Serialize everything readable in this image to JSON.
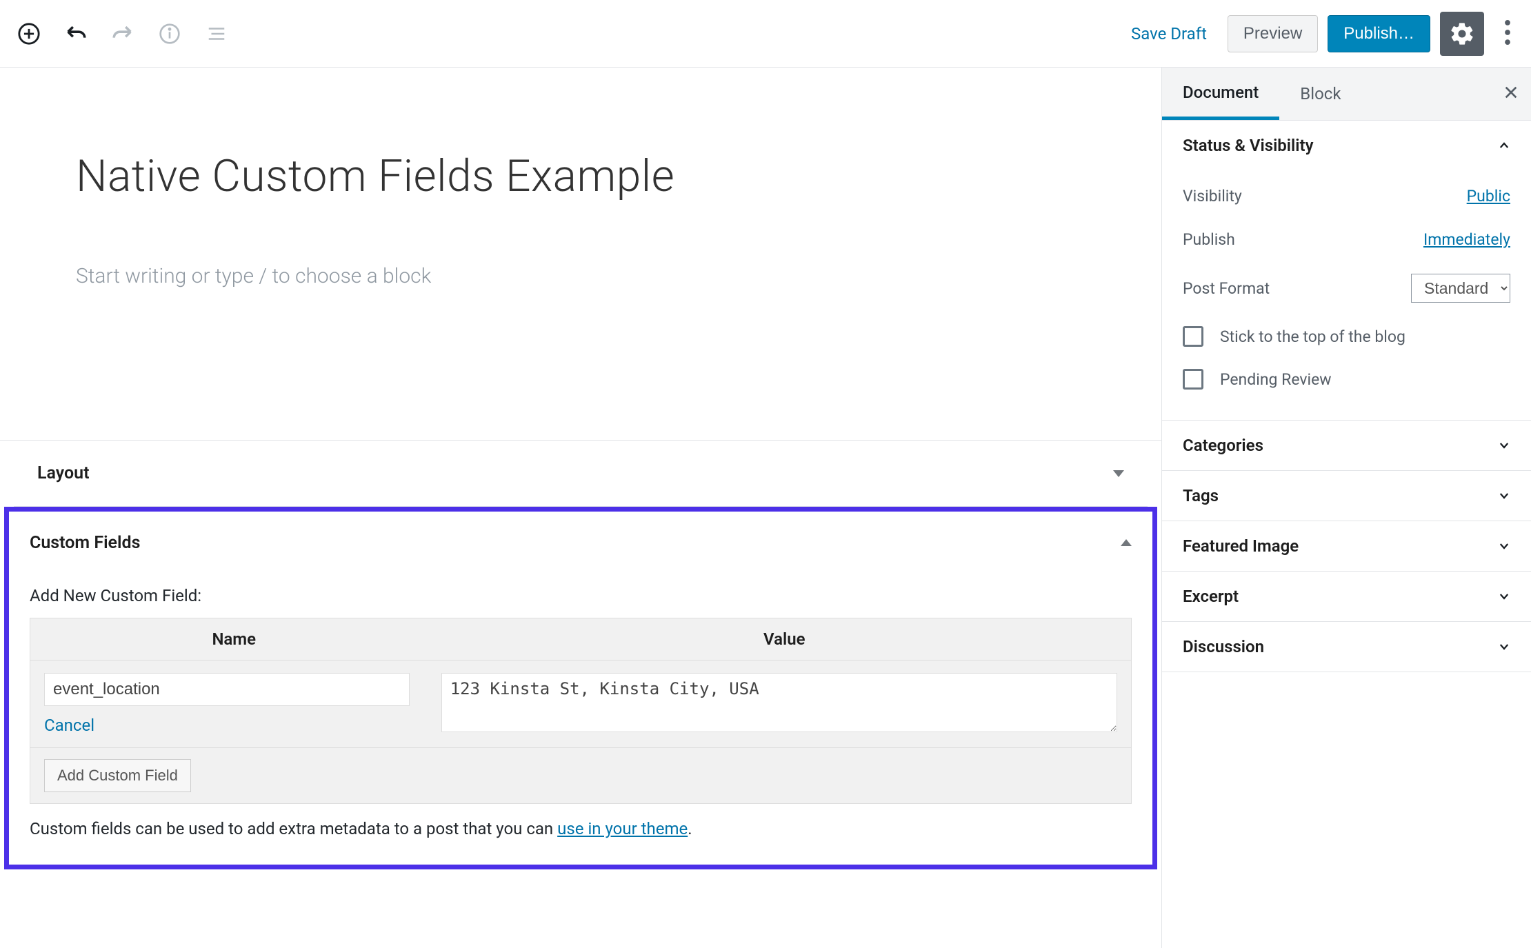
{
  "toolbar": {
    "save_draft": "Save Draft",
    "preview": "Preview",
    "publish": "Publish…"
  },
  "editor": {
    "post_title": "Native Custom Fields Example",
    "block_placeholder": "Start writing or type / to choose a block"
  },
  "metaboxes": {
    "layout_title": "Layout",
    "custom_fields": {
      "title": "Custom Fields",
      "add_new_label": "Add New Custom Field:",
      "name_header": "Name",
      "value_header": "Value",
      "name_value": "event_location",
      "value_value": "123 Kinsta St, Kinsta City, USA",
      "cancel": "Cancel",
      "add_button": "Add Custom Field",
      "help_text": "Custom fields can be used to add extra metadata to a post that you can ",
      "help_link": "use in your theme"
    }
  },
  "sidebar": {
    "tabs": {
      "document": "Document",
      "block": "Block"
    },
    "status": {
      "title": "Status & Visibility",
      "visibility_label": "Visibility",
      "visibility_value": "Public",
      "publish_label": "Publish",
      "publish_value": "Immediately",
      "format_label": "Post Format",
      "format_value": "Standard",
      "sticky": "Stick to the top of the blog",
      "pending": "Pending Review"
    },
    "panels": {
      "categories": "Categories",
      "tags": "Tags",
      "featured_image": "Featured Image",
      "excerpt": "Excerpt",
      "discussion": "Discussion"
    }
  }
}
